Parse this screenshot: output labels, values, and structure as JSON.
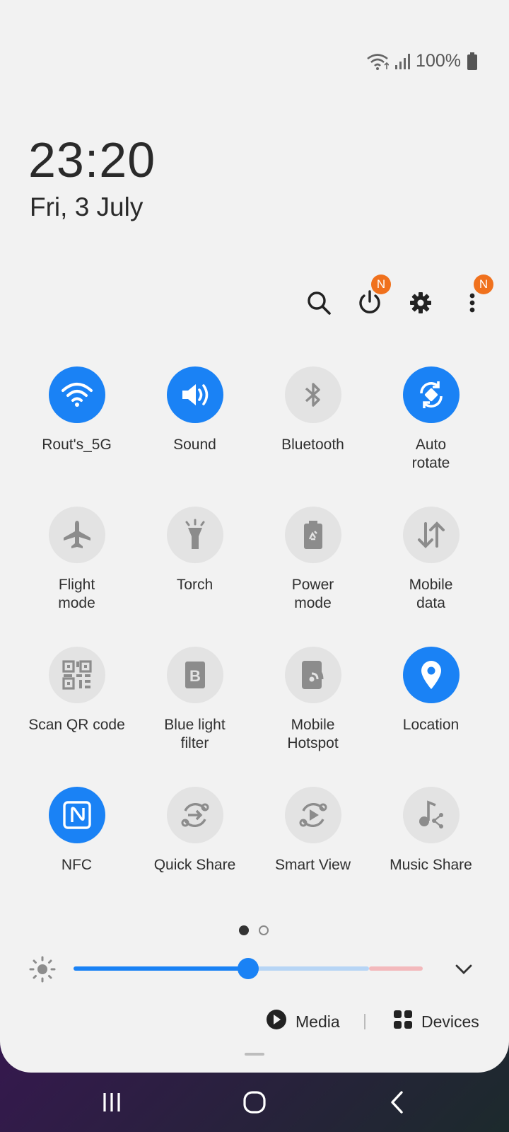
{
  "status_bar": {
    "battery_text": "100%",
    "icons": [
      "wifi-icon",
      "signal-icon",
      "battery-icon"
    ]
  },
  "clock": {
    "time": "23:20",
    "date": "Fri, 3 July"
  },
  "header_actions": {
    "icons": [
      "search-icon",
      "power-icon",
      "settings-icon",
      "more-options-icon"
    ],
    "power_badge": "N",
    "more_badge": "N"
  },
  "tiles": [
    {
      "label": "Rout's_5G",
      "icon": "wifi-icon",
      "on": true
    },
    {
      "label": "Sound",
      "icon": "sound-icon",
      "on": true
    },
    {
      "label": "Bluetooth",
      "icon": "bluetooth-icon",
      "on": false
    },
    {
      "label": "Auto\nrotate",
      "icon": "auto-rotate-icon",
      "on": true
    },
    {
      "label": "Flight\nmode",
      "icon": "airplane-icon",
      "on": false
    },
    {
      "label": "Torch",
      "icon": "torch-icon",
      "on": false
    },
    {
      "label": "Power\nmode",
      "icon": "power-mode-icon",
      "on": false
    },
    {
      "label": "Mobile\ndata",
      "icon": "mobile-data-icon",
      "on": false
    },
    {
      "label": "Scan QR code",
      "icon": "qr-code-icon",
      "on": false
    },
    {
      "label": "Blue light\nfilter",
      "icon": "blue-light-icon",
      "on": false
    },
    {
      "label": "Mobile\nHotspot",
      "icon": "hotspot-icon",
      "on": false
    },
    {
      "label": "Location",
      "icon": "location-icon",
      "on": true
    },
    {
      "label": "NFC",
      "icon": "nfc-icon",
      "on": true
    },
    {
      "label": "Quick Share",
      "icon": "quick-share-icon",
      "on": false
    },
    {
      "label": "Smart View",
      "icon": "smart-view-icon",
      "on": false
    },
    {
      "label": "Music Share",
      "icon": "music-share-icon",
      "on": false
    }
  ],
  "page_indicator": {
    "pages": 2,
    "current": 1
  },
  "brightness": {
    "level": 0.5,
    "expand_icon": "chevron-down-icon"
  },
  "media_row": {
    "media_label": "Media",
    "devices_label": "Devices"
  },
  "navigation": {
    "buttons": [
      "recents-icon",
      "home-icon",
      "back-icon"
    ]
  },
  "colors": {
    "accent": "#1a82f5",
    "tile_off": "#e3e3e3",
    "badge": "#f0711d",
    "panel_bg": "#f2f2f2"
  }
}
